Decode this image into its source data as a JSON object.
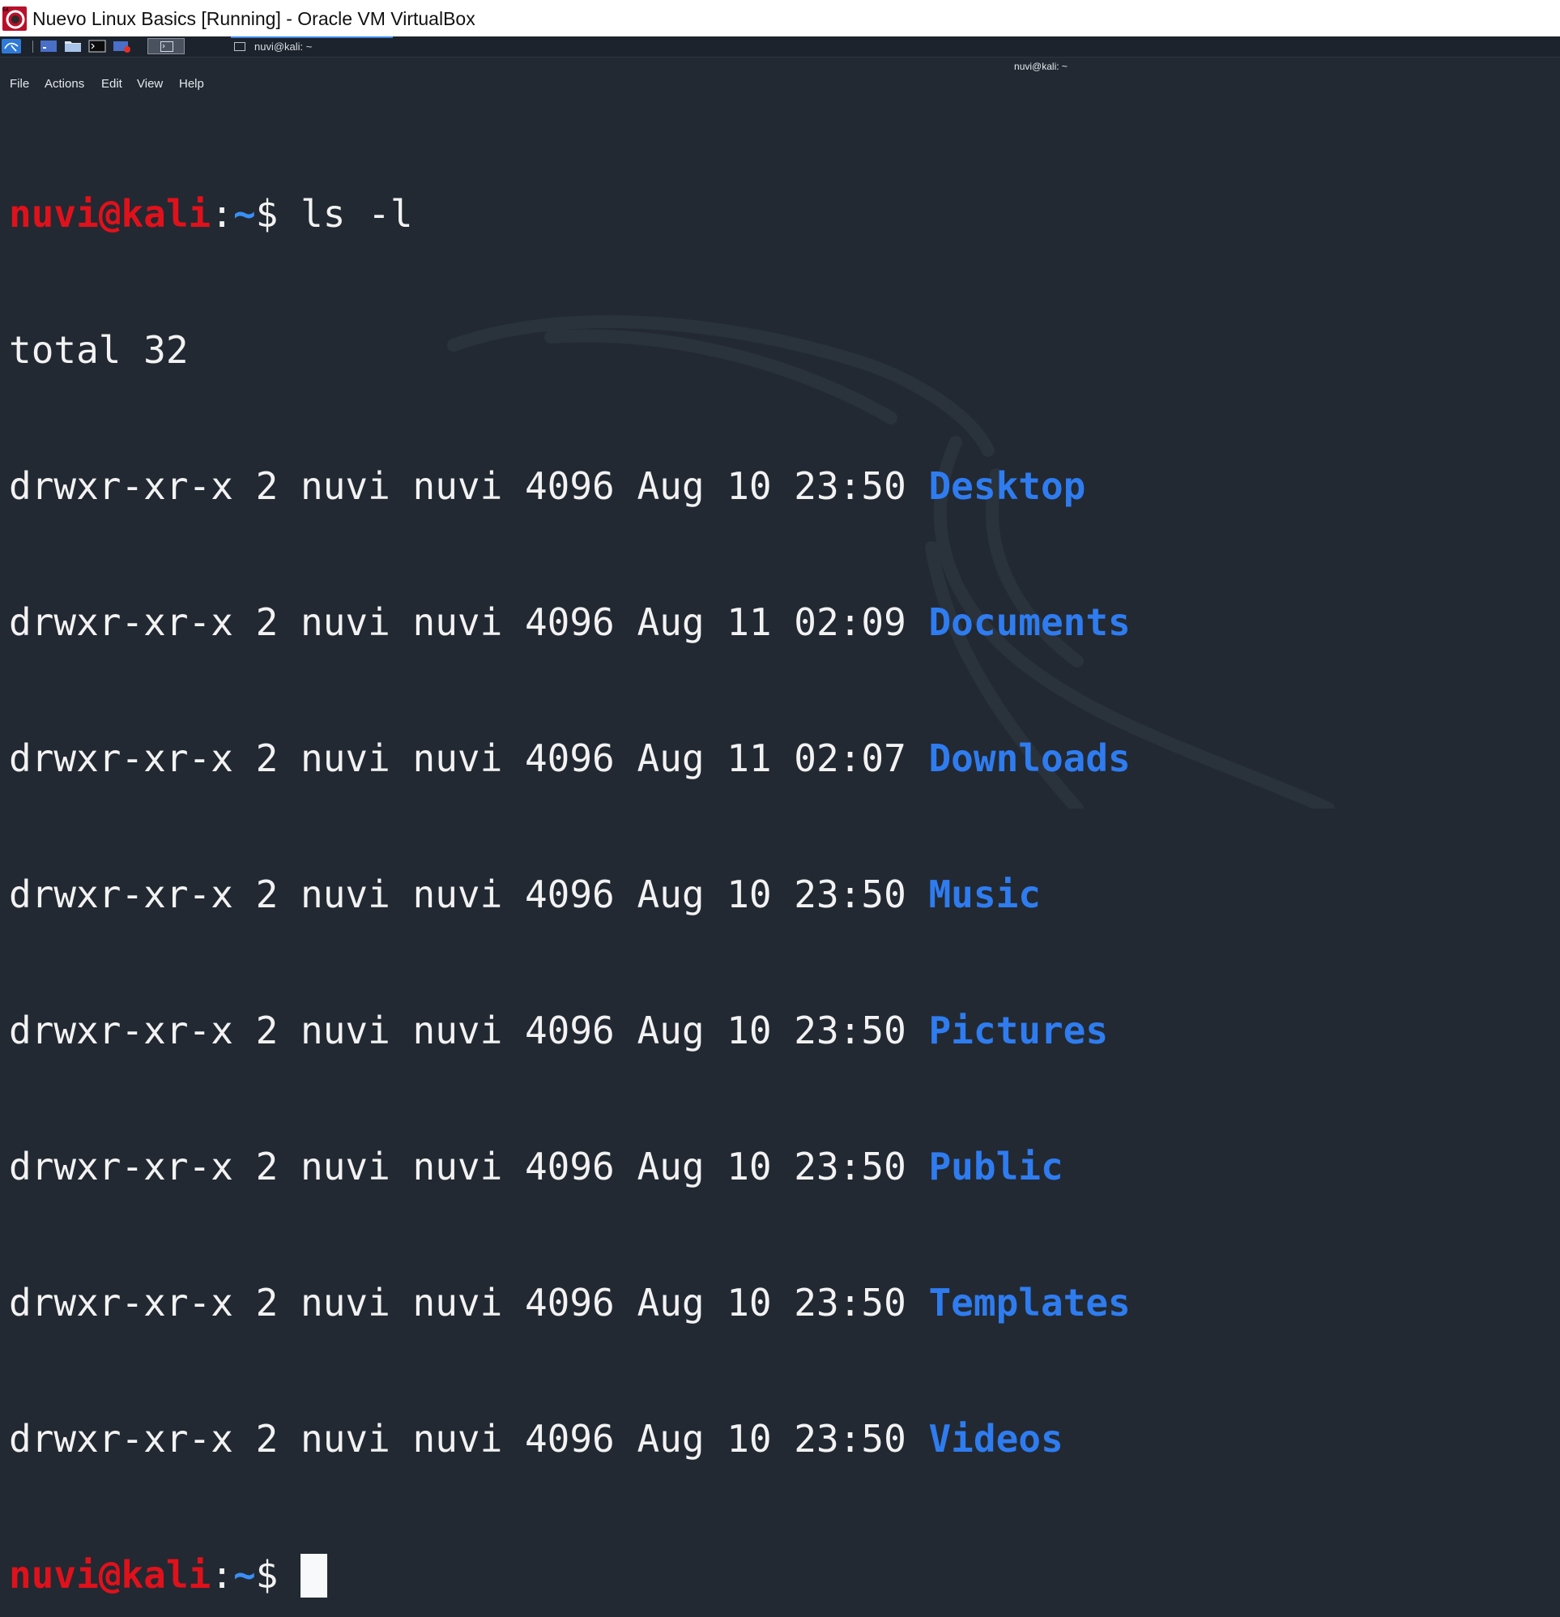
{
  "window": {
    "title": "Nuevo Linux Basics [Running] - Oracle VM VirtualBox",
    "icon": "virtualbox-icon"
  },
  "panel": {
    "launchers": [
      "kali-menu-icon",
      "workspace-icon",
      "file-manager-icon",
      "terminal-icon",
      "recorder-icon"
    ],
    "task_label": "nuvi@kali: ~"
  },
  "terminal": {
    "title": "nuvi@kali: ~",
    "menu": [
      "File",
      "Actions",
      "Edit",
      "View",
      "Help"
    ],
    "prompt": {
      "user": "nuvi@kali",
      "colon": ":",
      "path": "~",
      "dollar": "$"
    },
    "command": "ls -l",
    "total": "total 32",
    "entries": [
      {
        "meta": "drwxr-xr-x 2 nuvi nuvi 4096 Aug 10 23:50",
        "name": "Desktop"
      },
      {
        "meta": "drwxr-xr-x 2 nuvi nuvi 4096 Aug 11 02:09",
        "name": "Documents"
      },
      {
        "meta": "drwxr-xr-x 2 nuvi nuvi 4096 Aug 11 02:07",
        "name": "Downloads"
      },
      {
        "meta": "drwxr-xr-x 2 nuvi nuvi 4096 Aug 10 23:50",
        "name": "Music"
      },
      {
        "meta": "drwxr-xr-x 2 nuvi nuvi 4096 Aug 10 23:50",
        "name": "Pictures"
      },
      {
        "meta": "drwxr-xr-x 2 nuvi nuvi 4096 Aug 10 23:50",
        "name": "Public"
      },
      {
        "meta": "drwxr-xr-x 2 nuvi nuvi 4096 Aug 10 23:50",
        "name": "Templates"
      },
      {
        "meta": "drwxr-xr-x 2 nuvi nuvi 4096 Aug 10 23:50",
        "name": "Videos"
      }
    ],
    "colors": {
      "background": "#222932",
      "user": "#e0111b",
      "path": "#3a8ff5",
      "directory": "#2f7cf0",
      "text": "#f2f2f2"
    }
  }
}
